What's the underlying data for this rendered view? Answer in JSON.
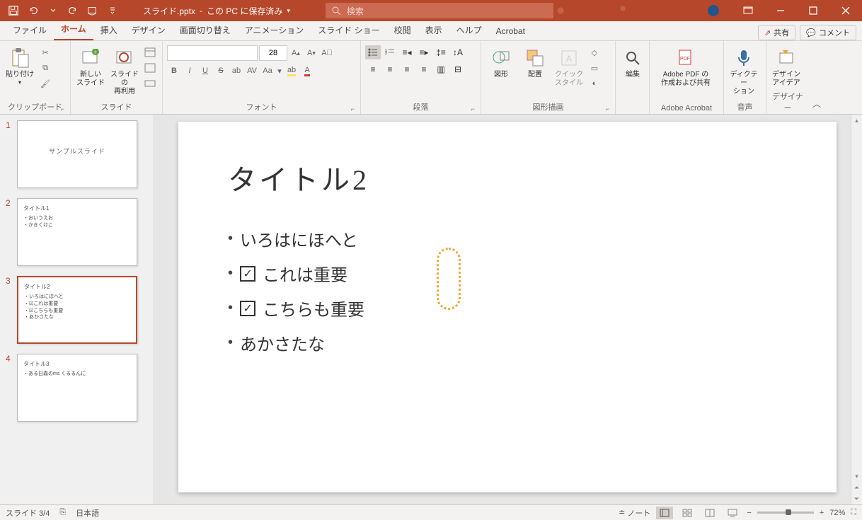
{
  "titlebar": {
    "doc_name": "スライド.pptx",
    "save_status": "この PC に保存済み",
    "search_placeholder": "検索"
  },
  "tabs": {
    "file": "ファイル",
    "home": "ホーム",
    "insert": "挿入",
    "design": "デザイン",
    "transitions": "画面切り替え",
    "animations": "アニメーション",
    "slideshow": "スライド ショー",
    "review": "校閲",
    "view": "表示",
    "help": "ヘルプ",
    "acrobat": "Acrobat",
    "share": "共有",
    "comments": "コメント"
  },
  "ribbon": {
    "clipboard": {
      "label": "クリップボード",
      "paste": "貼り付け"
    },
    "slides": {
      "label": "スライド",
      "new_slide": "新しい\nスライド",
      "reuse": "スライドの\n再利用"
    },
    "font": {
      "label": "フォント",
      "size": "28"
    },
    "paragraph": {
      "label": "段落"
    },
    "drawing": {
      "label": "図形描画",
      "shapes": "図形",
      "arrange": "配置",
      "quick_styles": "クイック\nスタイル"
    },
    "editing": {
      "label": "編集",
      "btn": "編集"
    },
    "adobe": {
      "label": "Adobe Acrobat",
      "btn": "Adobe PDF の\n作成および共有"
    },
    "voice": {
      "label": "音声",
      "btn": "ディクテー\nション"
    },
    "designer": {
      "label": "デザイナー",
      "btn": "デザイン\nアイデア"
    }
  },
  "thumbnails": [
    {
      "num": "1",
      "title": "サンプルスライド",
      "body": "",
      "center": true
    },
    {
      "num": "2",
      "title": "タイトル1",
      "body": "・おいうえお\n・かきくけこ"
    },
    {
      "num": "3",
      "title": "タイトル2",
      "body": "・いろはにほへと\n・☑これは重要\n・☑こちらも重要\n・あかさたな",
      "selected": true
    },
    {
      "num": "4",
      "title": "タイトル3",
      "body": "・ある日森のms くるるんに"
    }
  ],
  "slide": {
    "title": "タイトル2",
    "items": [
      {
        "text": "いろはにほへと",
        "checkbox": false
      },
      {
        "text": "これは重要",
        "checkbox": true
      },
      {
        "text": "こちらも重要",
        "checkbox": true
      },
      {
        "text": "あかさたな",
        "checkbox": false
      }
    ]
  },
  "statusbar": {
    "slide_counter": "スライド 3/4",
    "language": "日本語",
    "notes": "ノート",
    "zoom": "72%"
  }
}
